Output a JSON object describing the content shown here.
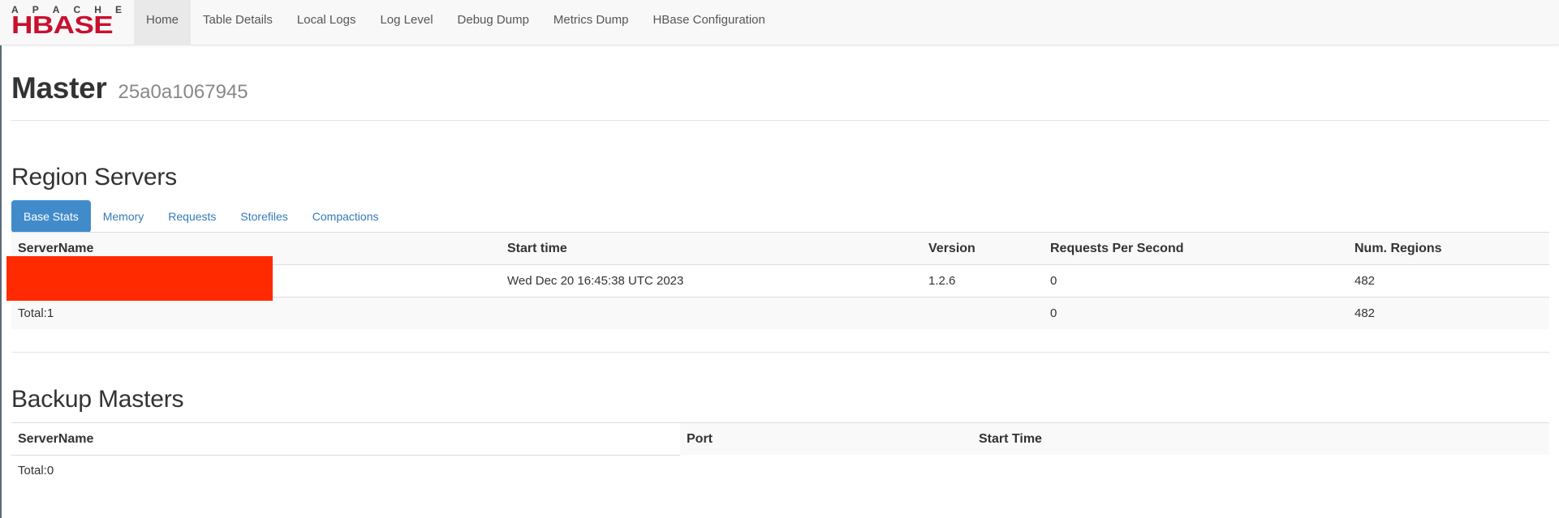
{
  "logo": {
    "top_letters": [
      "A",
      "P",
      "A",
      "C",
      "H",
      "E"
    ],
    "wordmark": "HBASE",
    "brand_color": "#c8102e"
  },
  "nav": {
    "items": [
      {
        "label": "Home",
        "active": true
      },
      {
        "label": "Table Details"
      },
      {
        "label": "Local Logs"
      },
      {
        "label": "Log Level"
      },
      {
        "label": "Debug Dump"
      },
      {
        "label": "Metrics Dump"
      },
      {
        "label": "HBase Configuration"
      }
    ]
  },
  "header": {
    "title": "Master",
    "subtitle": "25a0a1067945"
  },
  "region_servers": {
    "title": "Region Servers",
    "tabs": [
      {
        "label": "Base Stats",
        "active": true
      },
      {
        "label": "Memory"
      },
      {
        "label": "Requests"
      },
      {
        "label": "Storefiles"
      },
      {
        "label": "Compactions"
      }
    ],
    "columns": [
      "ServerName",
      "Start time",
      "Version",
      "Requests Per Second",
      "Num. Regions"
    ],
    "rows": [
      {
        "server_name": "",
        "start_time": "Wed Dec 20 16:45:38 UTC 2023",
        "version": "1.2.6",
        "requests_per_second": "0",
        "num_regions": "482"
      }
    ],
    "total": {
      "label": "Total:1",
      "requests_per_second": "0",
      "num_regions": "482"
    }
  },
  "backup_masters": {
    "title": "Backup Masters",
    "columns": [
      "ServerName",
      "Port",
      "Start Time"
    ],
    "total": {
      "label": "Total:0"
    }
  },
  "colors": {
    "accent": "#428bca",
    "link": "#337ab7",
    "redaction": "#ff2a00"
  }
}
